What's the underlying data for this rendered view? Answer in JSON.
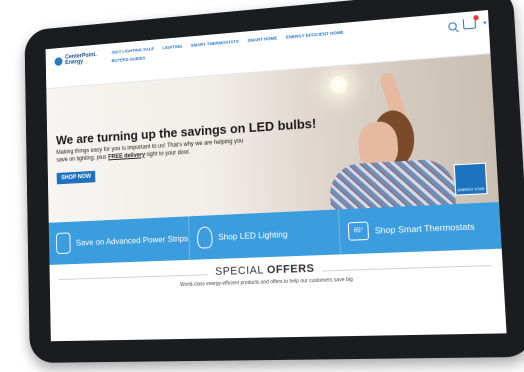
{
  "brand": {
    "name": "CenterPoint. Energy"
  },
  "nav": {
    "items": [
      "JULY LIGHTING SALE",
      "LIGHTING",
      "SMART THERMOSTATS",
      "SMART HOME",
      "ENERGY EFFICIENT HOME",
      "BUYERS GUIDES"
    ]
  },
  "header": {
    "icons": [
      "search-icon",
      "cart-icon",
      "chevron-down-icon"
    ],
    "cart_badge_color": "#e53935"
  },
  "hero": {
    "title": "We are turning up the savings on LED bulbs!",
    "subtitle_part1": "Making things easy for you is important to us! That's why we are helping you save on lighting, plus ",
    "subtitle_link": "FREE delivery",
    "subtitle_part2": " right to your door.",
    "cta": "SHOP NOW",
    "badge": "ENERGY STAR"
  },
  "promo": {
    "items": [
      {
        "label": "Save on Advanced Power Strips",
        "icon": "power-strip-icon"
      },
      {
        "label": "Shop LED Lighting",
        "icon": "light-bulb-icon"
      },
      {
        "label": "Shop Smart Thermostats",
        "icon": "thermostat-icon",
        "icon_text": "65°"
      }
    ]
  },
  "special": {
    "title_a": "SPECIAL",
    "title_b": "OFFERS",
    "subtitle": "World-class energy-efficient products and offers to help our customers save big"
  },
  "colors": {
    "accent": "#1e73be",
    "promo_bar": "#3b9ddd",
    "tablet_frame": "#1b1c1f"
  }
}
